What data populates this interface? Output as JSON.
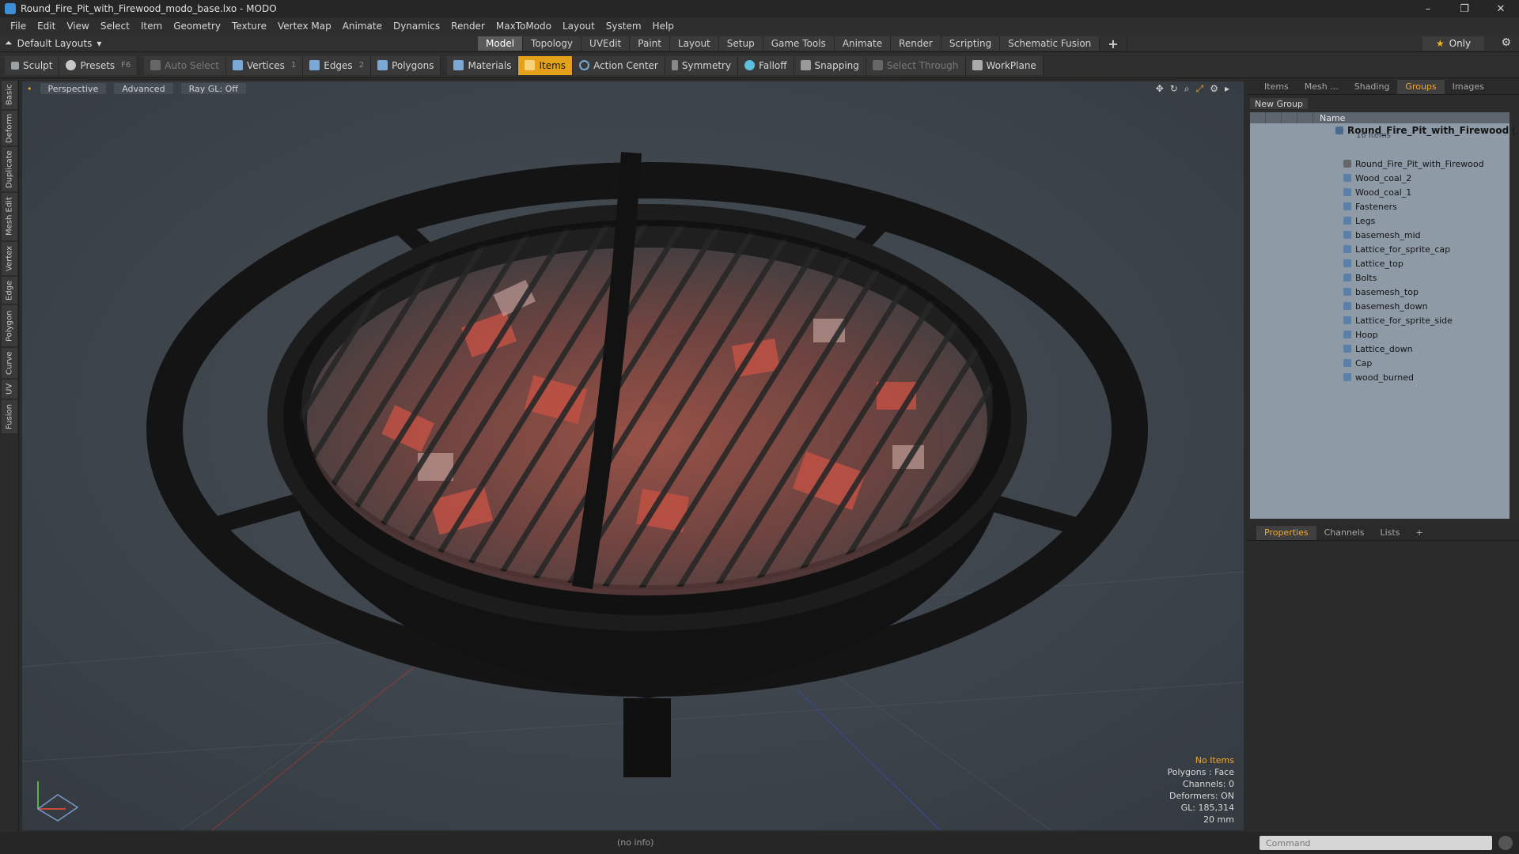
{
  "window": {
    "title": "Round_Fire_Pit_with_Firewood_modo_base.lxo - MODO",
    "buttons": [
      "–",
      "❐",
      "✕"
    ]
  },
  "menu": [
    "File",
    "Edit",
    "View",
    "Select",
    "Item",
    "Geometry",
    "Texture",
    "Vertex Map",
    "Animate",
    "Dynamics",
    "Render",
    "MaxToModo",
    "Layout",
    "System",
    "Help"
  ],
  "layoutbar": {
    "layouts_label": "Default Layouts",
    "tabs": [
      "Model",
      "Topology",
      "UVEdit",
      "Paint",
      "Layout",
      "Setup",
      "Game Tools",
      "Animate",
      "Render",
      "Scripting",
      "Schematic Fusion"
    ],
    "active_tab": "Model",
    "plus": "+",
    "only_label": "Only"
  },
  "toolbar": {
    "sculpt": "Sculpt",
    "presets": "Presets",
    "presets_key": "F6",
    "auto_select": "Auto Select",
    "vertices": "Vertices",
    "vertices_num": "1",
    "edges": "Edges",
    "edges_num": "2",
    "polygons": "Polygons",
    "materials": "Materials",
    "items": "Items",
    "action_center": "Action Center",
    "symmetry": "Symmetry",
    "falloff": "Falloff",
    "snapping": "Snapping",
    "select_through": "Select Through",
    "workplane": "WorkPlane"
  },
  "left_tabs": [
    "Basic",
    "Deform",
    "Duplicate",
    "Mesh Edit",
    "Vertex",
    "Edge",
    "Polygon",
    "Curve",
    "UV",
    "Fusion"
  ],
  "viewport": {
    "view": "Perspective",
    "shading": "Advanced",
    "raygl": "Ray GL: Off",
    "info": {
      "items": "No Items",
      "polygons": "Polygons : Face",
      "channels": "Channels: 0",
      "deformers": "Deformers: ON",
      "gl": "GL: 185,314",
      "size": "20 mm"
    }
  },
  "groups_panel": {
    "tabs": [
      "Items",
      "Mesh ...",
      "Shading",
      "Groups",
      "Images"
    ],
    "active_tab": "Groups",
    "new_group": "New Group",
    "column_name": "Name",
    "root": "Round_Fire_Pit_with_Firewood",
    "root_suffix": "(...",
    "root_count": "16 Items",
    "items": [
      "Round_Fire_Pit_with_Firewood",
      "Wood_coal_2",
      "Wood_coal_1",
      "Fasteners",
      "Legs",
      "basemesh_mid",
      "Lattice_for_sprite_cap",
      "Lattice_top",
      "Bolts",
      "basemesh_top",
      "basemesh_down",
      "Lattice_for_sprite_side",
      "Hoop",
      "Lattice_down",
      "Cap",
      "wood_burned"
    ]
  },
  "properties_panel": {
    "tabs": [
      "Properties",
      "Channels",
      "Lists"
    ],
    "active_tab": "Properties",
    "plus": "+"
  },
  "status": {
    "info": "(no info)",
    "command_placeholder": "Command"
  }
}
